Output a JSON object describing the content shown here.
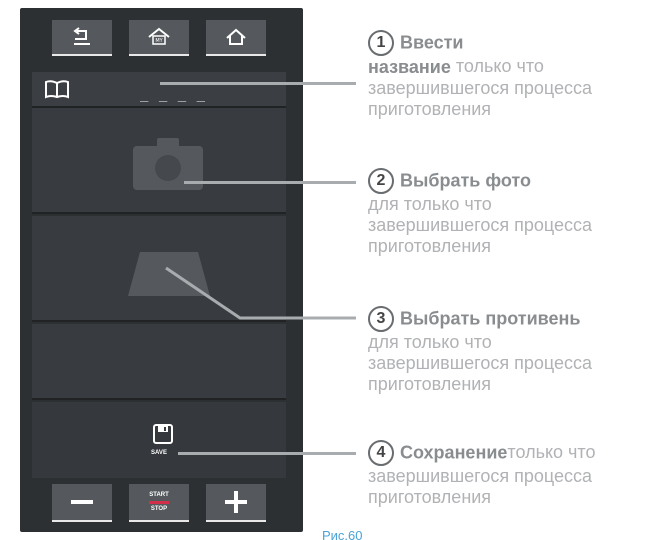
{
  "panel": {
    "name_placeholder": "_ _ _ _",
    "save_label": "SAVE",
    "start_label": "START",
    "stop_label": "STOP",
    "icons": {
      "top": [
        "back-icon",
        "my-home-icon",
        "home-icon"
      ],
      "name_row": "book-icon",
      "photo_row": "camera-icon",
      "pan_row": "baking-tray-icon",
      "save_row": "save-icon",
      "bottom": [
        "minus-icon",
        "start-stop-icon",
        "plus-icon"
      ]
    },
    "colors": {
      "panel_bg": "#2d3033",
      "button_bg": "#55595d",
      "accent_red": "#d0304a"
    }
  },
  "annotations": [
    {
      "number": "1",
      "title": "Ввести",
      "title_cont": "название",
      "desc_inline": " только что",
      "desc_lines": [
        "завершившегося процесса",
        "приготовления"
      ]
    },
    {
      "number": "2",
      "title": "Выбрать фото",
      "desc_lines": [
        "для только что",
        "завершившегося процесса",
        "приготовления"
      ]
    },
    {
      "number": "3",
      "title": "Выбрать противень",
      "desc_lines": [
        "для только что",
        "завершившегося процесса",
        "приготовления"
      ]
    },
    {
      "number": "4",
      "title": "Сохранение",
      "desc_inline": "только что",
      "desc_lines": [
        "завершившегося процесса",
        "приготовления"
      ]
    }
  ],
  "figure_caption": "Рис.60"
}
